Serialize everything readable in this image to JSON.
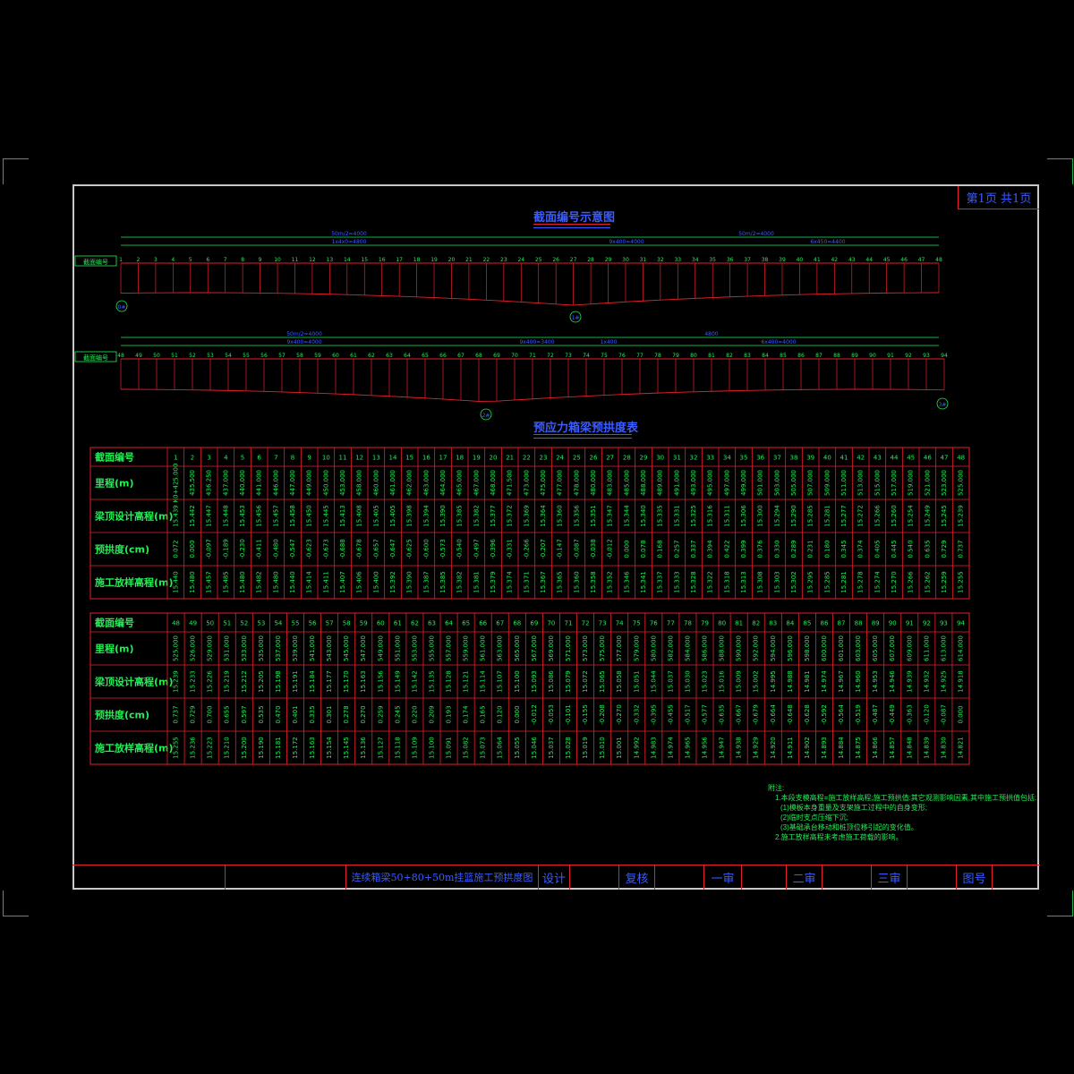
{
  "page_label": "第1页 共1页",
  "diagram_title": "截面编号示意图",
  "table_title": "预应力箱梁预拱度表",
  "section_label": "截面编号",
  "row_labels": [
    "截面编号",
    "里程(m)",
    "梁顶设计高程(m)",
    "预拱度(cm)",
    "施工放样高程(m)"
  ],
  "spans_top": [
    "50m/2=4000",
    "1x4x0=4800",
    "9x400=4000",
    "6x450=4400",
    "50m/2=4000",
    "8x460=4800"
  ],
  "spans_bottom": [
    "50m/2=4000",
    "9x400=4000",
    "9x400=3400",
    "1x400",
    "4800",
    "6x400=4000"
  ],
  "piers": [
    "0#",
    "1#",
    "2#",
    "3#"
  ],
  "sections_upper": [
    "1",
    "2",
    "3",
    "4",
    "5",
    "6",
    "7",
    "8",
    "9",
    "10",
    "11",
    "12",
    "13",
    "14",
    "15",
    "16",
    "17",
    "18",
    "19",
    "20",
    "21",
    "22",
    "23",
    "24",
    "25",
    "26",
    "27",
    "28",
    "29",
    "30",
    "31",
    "32",
    "33",
    "34",
    "35",
    "36",
    "37",
    "38",
    "39",
    "40",
    "41",
    "42",
    "43",
    "44",
    "45",
    "46",
    "47",
    "48"
  ],
  "sections_lower": [
    "48",
    "49",
    "50",
    "51",
    "52",
    "53",
    "54",
    "55",
    "56",
    "57",
    "58",
    "59",
    "60",
    "61",
    "62",
    "63",
    "64",
    "65",
    "66",
    "67",
    "68",
    "69",
    "70",
    "71",
    "72",
    "73",
    "74",
    "75",
    "76",
    "77",
    "78",
    "79",
    "80",
    "81",
    "82",
    "83",
    "84",
    "85",
    "86",
    "87",
    "88",
    "89",
    "90",
    "91",
    "92",
    "93",
    "94"
  ],
  "table1": {
    "sections": [
      "1",
      "2",
      "3",
      "4",
      "5",
      "6",
      "7",
      "8",
      "9",
      "10",
      "11",
      "12",
      "13",
      "14",
      "15",
      "16",
      "17",
      "18",
      "19",
      "20",
      "21",
      "22",
      "23",
      "24",
      "25",
      "26",
      "27",
      "28",
      "29",
      "30",
      "31",
      "32",
      "33",
      "34",
      "35",
      "36",
      "37",
      "38",
      "39",
      "40",
      "41",
      "42",
      "43",
      "44",
      "45",
      "46",
      "47",
      "48"
    ],
    "mileage": [
      "K0+425.000",
      "435.500",
      "436.250",
      "437.000",
      "440.000",
      "441.000",
      "446.000",
      "447.000",
      "449.000",
      "450.000",
      "453.000",
      "458.000",
      "460.000",
      "461.000",
      "462.000",
      "463.000",
      "464.000",
      "465.000",
      "467.000",
      "468.000",
      "471.500",
      "473.000",
      "475.000",
      "477.000",
      "478.000",
      "480.000",
      "483.000",
      "485.000",
      "488.000",
      "489.000",
      "491.000",
      "493.000",
      "495.000",
      "497.000",
      "499.000",
      "501.000",
      "503.000",
      "505.000",
      "507.000",
      "509.000",
      "511.000",
      "513.000",
      "515.000",
      "517.000",
      "519.000",
      "521.000",
      "523.000",
      "525.000"
    ],
    "design": [
      "15.439",
      "15.442",
      "15.447",
      "15.448",
      "15.453",
      "15.456",
      "15.457",
      "15.458",
      "15.450",
      "15.445",
      "15.413",
      "15.408",
      "15.405",
      "15.405",
      "15.398",
      "15.394",
      "15.390",
      "15.385",
      "15.382",
      "15.377",
      "15.372",
      "15.369",
      "15.364",
      "15.360",
      "15.356",
      "15.351",
      "15.347",
      "15.344",
      "15.340",
      "15.335",
      "15.331",
      "15.325",
      "15.316",
      "15.311",
      "15.306",
      "15.300",
      "15.294",
      "15.290",
      "15.285",
      "15.281",
      "15.277",
      "15.272",
      "15.266",
      "15.260",
      "15.254",
      "15.249",
      "15.245",
      "15.239"
    ],
    "camber": [
      "0.072",
      "0.000",
      "-0.097",
      "-0.189",
      "-0.230",
      "-0.411",
      "-0.480",
      "-0.547",
      "-0.623",
      "-0.673",
      "-0.688",
      "-0.678",
      "-0.657",
      "-0.647",
      "-0.625",
      "-0.600",
      "-0.573",
      "-0.540",
      "-0.497",
      "-0.396",
      "-0.331",
      "-0.266",
      "-0.207",
      "-0.147",
      "-0.087",
      "-0.038",
      "-0.012",
      "0.000",
      "0.078",
      "0.168",
      "0.257",
      "0.337",
      "0.394",
      "0.422",
      "0.399",
      "0.376",
      "0.330",
      "0.289",
      "0.231",
      "0.180",
      "0.345",
      "0.374",
      "0.405",
      "0.445",
      "0.540",
      "0.635",
      "0.729",
      "0.737"
    ],
    "construct": [
      "15.440",
      "15.480",
      "15.457",
      "15.485",
      "15.480",
      "15.482",
      "15.480",
      "15.440",
      "15.414",
      "15.411",
      "15.407",
      "15.406",
      "15.400",
      "15.392",
      "15.390",
      "15.387",
      "15.385",
      "15.382",
      "15.381",
      "15.379",
      "15.374",
      "15.371",
      "15.367",
      "15.365",
      "15.360",
      "15.358",
      "15.352",
      "15.346",
      "15.341",
      "15.337",
      "15.333",
      "15.328",
      "15.322",
      "15.318",
      "15.313",
      "15.308",
      "15.303",
      "15.302",
      "15.295",
      "15.285",
      "15.281",
      "15.278",
      "15.274",
      "15.270",
      "15.266",
      "15.262",
      "15.259",
      "15.255"
    ]
  },
  "table2": {
    "sections": [
      "48",
      "49",
      "50",
      "51",
      "52",
      "53",
      "54",
      "55",
      "56",
      "57",
      "58",
      "59",
      "60",
      "61",
      "62",
      "63",
      "64",
      "65",
      "66",
      "67",
      "68",
      "69",
      "70",
      "71",
      "72",
      "73",
      "74",
      "75",
      "76",
      "77",
      "78",
      "79",
      "80",
      "81",
      "82",
      "83",
      "84",
      "85",
      "86",
      "87",
      "88",
      "89",
      "90",
      "91",
      "92",
      "93",
      "94"
    ],
    "mileage": [
      "525.000",
      "526.000",
      "529.000",
      "531.000",
      "533.000",
      "535.000",
      "537.000",
      "539.000",
      "541.000",
      "543.000",
      "545.000",
      "547.000",
      "549.000",
      "551.000",
      "553.000",
      "555.000",
      "557.000",
      "559.000",
      "561.000",
      "563.000",
      "565.000",
      "567.000",
      "569.000",
      "571.000",
      "573.000",
      "575.000",
      "577.000",
      "579.000",
      "580.000",
      "582.000",
      "584.000",
      "586.000",
      "588.000",
      "590.000",
      "592.000",
      "594.000",
      "596.000",
      "598.000",
      "600.000",
      "601.000",
      "603.000",
      "605.000",
      "607.000",
      "609.000",
      "611.000",
      "613.000",
      "614.000"
    ],
    "design": [
      "15.239",
      "15.233",
      "15.226",
      "15.219",
      "15.212",
      "15.205",
      "15.198",
      "15.191",
      "15.184",
      "15.177",
      "15.170",
      "15.163",
      "15.156",
      "15.149",
      "15.142",
      "15.135",
      "15.128",
      "15.121",
      "15.114",
      "15.107",
      "15.100",
      "15.093",
      "15.086",
      "15.079",
      "15.072",
      "15.065",
      "15.058",
      "15.051",
      "15.044",
      "15.037",
      "15.030",
      "15.023",
      "15.016",
      "15.009",
      "15.002",
      "14.995",
      "14.988",
      "14.981",
      "14.974",
      "14.967",
      "14.960",
      "14.953",
      "14.946",
      "14.939",
      "14.932",
      "14.925",
      "14.918"
    ],
    "camber": [
      "0.737",
      "0.729",
      "0.700",
      "0.655",
      "0.597",
      "0.535",
      "0.470",
      "0.401",
      "0.335",
      "0.301",
      "0.278",
      "0.270",
      "0.259",
      "0.245",
      "0.220",
      "0.209",
      "0.193",
      "0.174",
      "0.165",
      "0.120",
      "0.000",
      "-0.012",
      "-0.053",
      "-0.101",
      "-0.155",
      "-0.208",
      "-0.270",
      "-0.332",
      "-0.395",
      "-0.455",
      "-0.517",
      "-0.577",
      "-0.635",
      "-0.667",
      "-0.679",
      "-0.664",
      "-0.648",
      "-0.628",
      "-0.592",
      "-0.564",
      "-0.519",
      "-0.487",
      "-0.449",
      "-0.363",
      "-0.120",
      "-0.087",
      "0.000"
    ],
    "construct": [
      "15.255",
      "15.236",
      "15.223",
      "15.210",
      "15.200",
      "15.190",
      "15.181",
      "15.172",
      "15.163",
      "15.154",
      "15.145",
      "15.136",
      "15.127",
      "15.118",
      "15.109",
      "15.100",
      "15.091",
      "15.082",
      "15.073",
      "15.064",
      "15.055",
      "15.046",
      "15.037",
      "15.028",
      "15.019",
      "15.010",
      "15.001",
      "14.992",
      "14.983",
      "14.974",
      "14.965",
      "14.956",
      "14.947",
      "14.938",
      "14.929",
      "14.920",
      "14.911",
      "14.902",
      "14.893",
      "14.884",
      "14.875",
      "14.866",
      "14.857",
      "14.848",
      "14.839",
      "14.830",
      "14.821"
    ]
  },
  "notes": {
    "heading": "附注:",
    "lines": [
      "1.本段支模高程=施工放样高程;施工预拱值:其它观测影响因素,其中施工预拱值包括:",
      "(1)模板本身重量及支架施工过程中的自身变形;",
      "(2)临时支点压缩下沉;",
      "(3)基础承台移动和桩顶位移引起的变化值。",
      "2.施工放样高程未考虑施工荷载的影响。"
    ]
  },
  "title_block": {
    "drawing_name": "连续箱梁50+80+50m挂篮施工预拱度图",
    "design": "设计",
    "review": "复核",
    "first_review": "一审",
    "second_review": "二审",
    "third_review": "三审",
    "drawing_no": "图号"
  },
  "colors": {
    "frame": "#c8c8c8",
    "red": "#e8202a",
    "green": "#22ee55",
    "blue": "#3b5cff",
    "text_green": "#22ee55"
  }
}
